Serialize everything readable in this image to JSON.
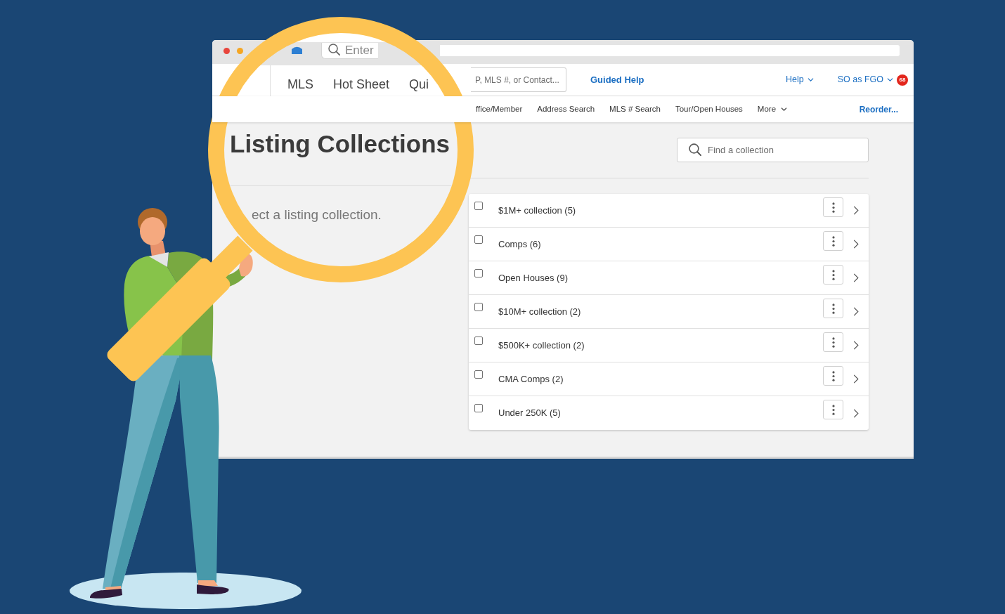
{
  "window": {
    "controls": [
      {
        "color": "#e8453c"
      },
      {
        "color": "#f5a623"
      }
    ]
  },
  "magnified_view": {
    "search": {
      "placeholder": "Enter"
    },
    "nav": [
      {
        "label": "MLS"
      },
      {
        "label": "Hot Sheet"
      },
      {
        "label": "Qui"
      }
    ],
    "title": "Listing Collections",
    "subtitle": "ect a listing collection."
  },
  "header": {
    "search": {
      "placeholder": "P, MLS #, or Contact..."
    },
    "guided_help": "Guided Help",
    "menus": [
      {
        "label": "Help"
      },
      {
        "label": "SO as FGO"
      }
    ],
    "notification_count": "68"
  },
  "subnav": {
    "items": [
      {
        "label": "ffice/Member",
        "dropdown": false
      },
      {
        "label": "Address Search",
        "dropdown": false
      },
      {
        "label": "MLS # Search",
        "dropdown": false
      },
      {
        "label": "Tour/Open Houses",
        "dropdown": false
      },
      {
        "label": "More",
        "dropdown": true
      }
    ],
    "reorder": "Reorder..."
  },
  "collections": {
    "search": {
      "placeholder": "Find a collection"
    },
    "items": [
      {
        "label": "$1M+ collection (5)",
        "checked": false
      },
      {
        "label": "Comps (6)",
        "checked": false
      },
      {
        "label": "Open Houses (9)",
        "checked": false
      },
      {
        "label": "$10M+ collection (2)",
        "checked": false
      },
      {
        "label": "$500K+ collection (2)",
        "checked": false
      },
      {
        "label": "CMA Comps (2)",
        "checked": false
      },
      {
        "label": "Under 250K (5)",
        "checked": false
      }
    ]
  }
}
